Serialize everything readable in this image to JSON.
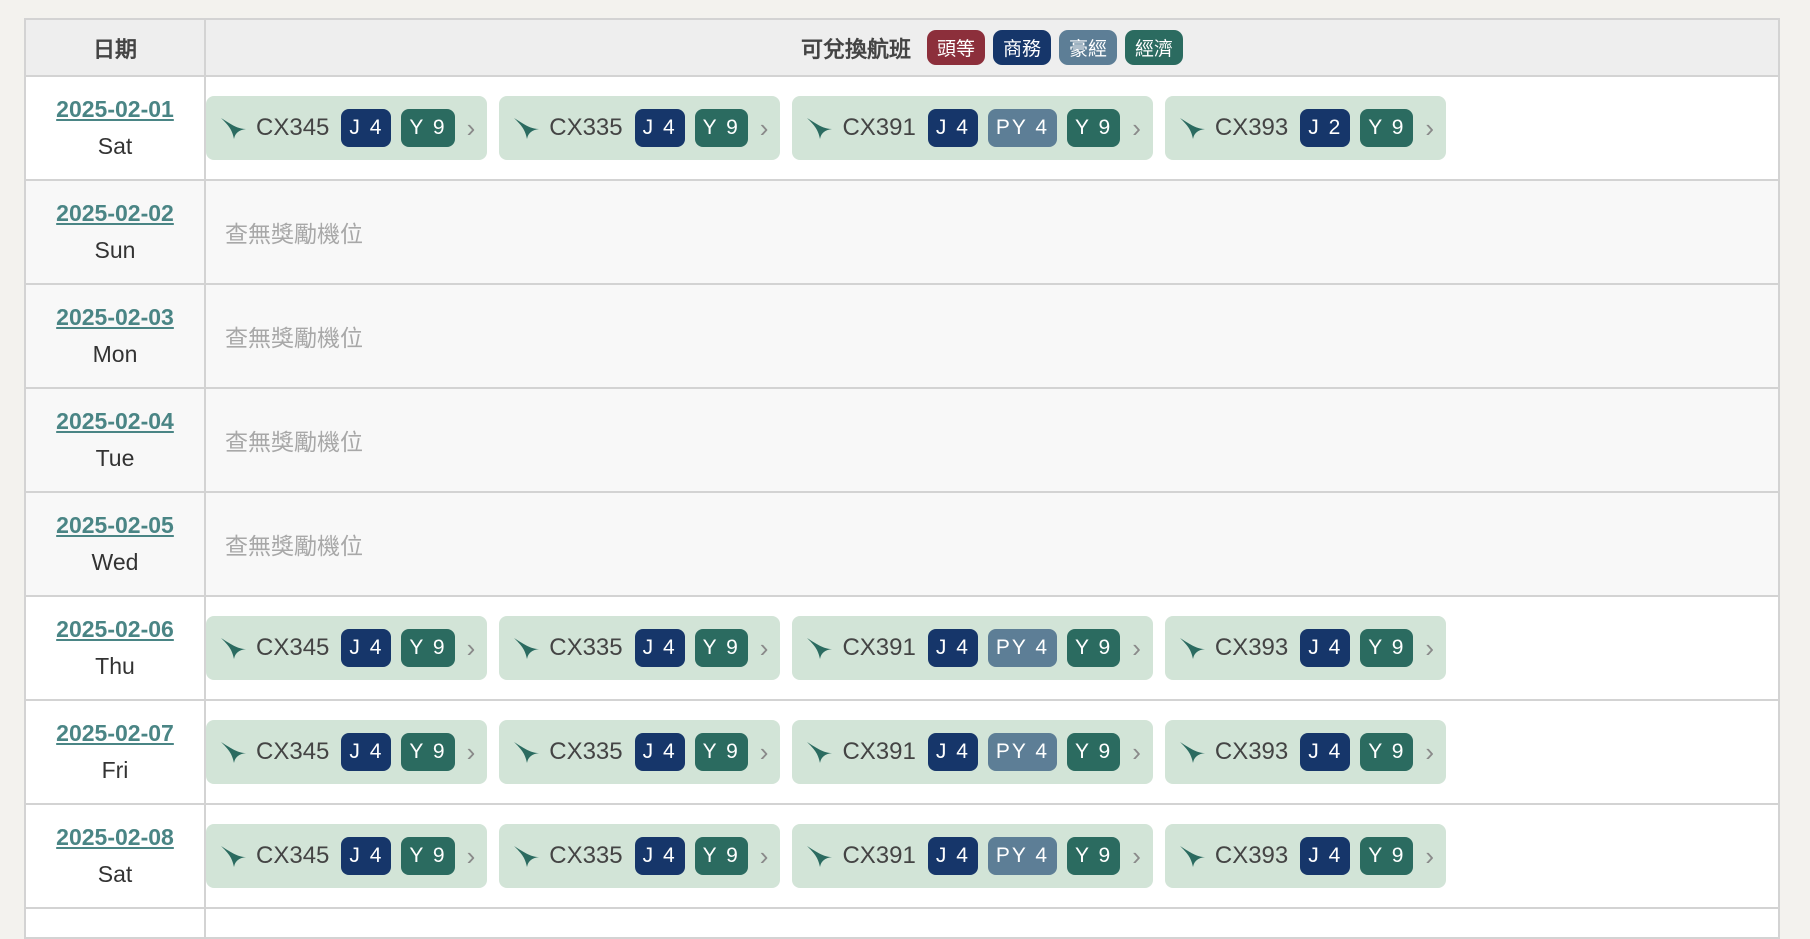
{
  "colors": {
    "first": "#8c2f3b",
    "business": "#16366a",
    "premium_economy": "#5d7e96",
    "economy": "#2b6b60",
    "chip_bg": "#d2e4d7",
    "date_link": "#4a8585"
  },
  "header": {
    "date_col": "日期",
    "flights_col": "可兌換航班",
    "legend": {
      "first": "頭等",
      "business": "商務",
      "premium_economy": "豪經",
      "economy": "經濟"
    }
  },
  "no_award_text": "查無獎勵機位",
  "rows": [
    {
      "date": "2025-02-01",
      "weekday": "Sat",
      "flights": [
        {
          "no": "CX345",
          "seats": [
            {
              "label": "J 4",
              "cls": "business"
            },
            {
              "label": "Y 9",
              "cls": "economy"
            }
          ]
        },
        {
          "no": "CX335",
          "seats": [
            {
              "label": "J 4",
              "cls": "business"
            },
            {
              "label": "Y 9",
              "cls": "economy"
            }
          ]
        },
        {
          "no": "CX391",
          "seats": [
            {
              "label": "J 4",
              "cls": "business"
            },
            {
              "label": "PY 4",
              "cls": "premium_economy"
            },
            {
              "label": "Y 9",
              "cls": "economy"
            }
          ]
        },
        {
          "no": "CX393",
          "seats": [
            {
              "label": "J 2",
              "cls": "business"
            },
            {
              "label": "Y 9",
              "cls": "economy"
            }
          ]
        }
      ]
    },
    {
      "date": "2025-02-02",
      "weekday": "Sun",
      "flights": []
    },
    {
      "date": "2025-02-03",
      "weekday": "Mon",
      "flights": []
    },
    {
      "date": "2025-02-04",
      "weekday": "Tue",
      "flights": []
    },
    {
      "date": "2025-02-05",
      "weekday": "Wed",
      "flights": []
    },
    {
      "date": "2025-02-06",
      "weekday": "Thu",
      "flights": [
        {
          "no": "CX345",
          "seats": [
            {
              "label": "J 4",
              "cls": "business"
            },
            {
              "label": "Y 9",
              "cls": "economy"
            }
          ]
        },
        {
          "no": "CX335",
          "seats": [
            {
              "label": "J 4",
              "cls": "business"
            },
            {
              "label": "Y 9",
              "cls": "economy"
            }
          ]
        },
        {
          "no": "CX391",
          "seats": [
            {
              "label": "J 4",
              "cls": "business"
            },
            {
              "label": "PY 4",
              "cls": "premium_economy"
            },
            {
              "label": "Y 9",
              "cls": "economy"
            }
          ]
        },
        {
          "no": "CX393",
          "seats": [
            {
              "label": "J 4",
              "cls": "business"
            },
            {
              "label": "Y 9",
              "cls": "economy"
            }
          ]
        }
      ]
    },
    {
      "date": "2025-02-07",
      "weekday": "Fri",
      "flights": [
        {
          "no": "CX345",
          "seats": [
            {
              "label": "J 4",
              "cls": "business"
            },
            {
              "label": "Y 9",
              "cls": "economy"
            }
          ]
        },
        {
          "no": "CX335",
          "seats": [
            {
              "label": "J 4",
              "cls": "business"
            },
            {
              "label": "Y 9",
              "cls": "economy"
            }
          ]
        },
        {
          "no": "CX391",
          "seats": [
            {
              "label": "J 4",
              "cls": "business"
            },
            {
              "label": "PY 4",
              "cls": "premium_economy"
            },
            {
              "label": "Y 9",
              "cls": "economy"
            }
          ]
        },
        {
          "no": "CX393",
          "seats": [
            {
              "label": "J 4",
              "cls": "business"
            },
            {
              "label": "Y 9",
              "cls": "economy"
            }
          ]
        }
      ]
    },
    {
      "date": "2025-02-08",
      "weekday": "Sat",
      "flights": [
        {
          "no": "CX345",
          "seats": [
            {
              "label": "J 4",
              "cls": "business"
            },
            {
              "label": "Y 9",
              "cls": "economy"
            }
          ]
        },
        {
          "no": "CX335",
          "seats": [
            {
              "label": "J 4",
              "cls": "business"
            },
            {
              "label": "Y 9",
              "cls": "economy"
            }
          ]
        },
        {
          "no": "CX391",
          "seats": [
            {
              "label": "J 4",
              "cls": "business"
            },
            {
              "label": "PY 4",
              "cls": "premium_economy"
            },
            {
              "label": "Y 9",
              "cls": "economy"
            }
          ]
        },
        {
          "no": "CX393",
          "seats": [
            {
              "label": "J 4",
              "cls": "business"
            },
            {
              "label": "Y 9",
              "cls": "economy"
            }
          ]
        }
      ]
    }
  ]
}
